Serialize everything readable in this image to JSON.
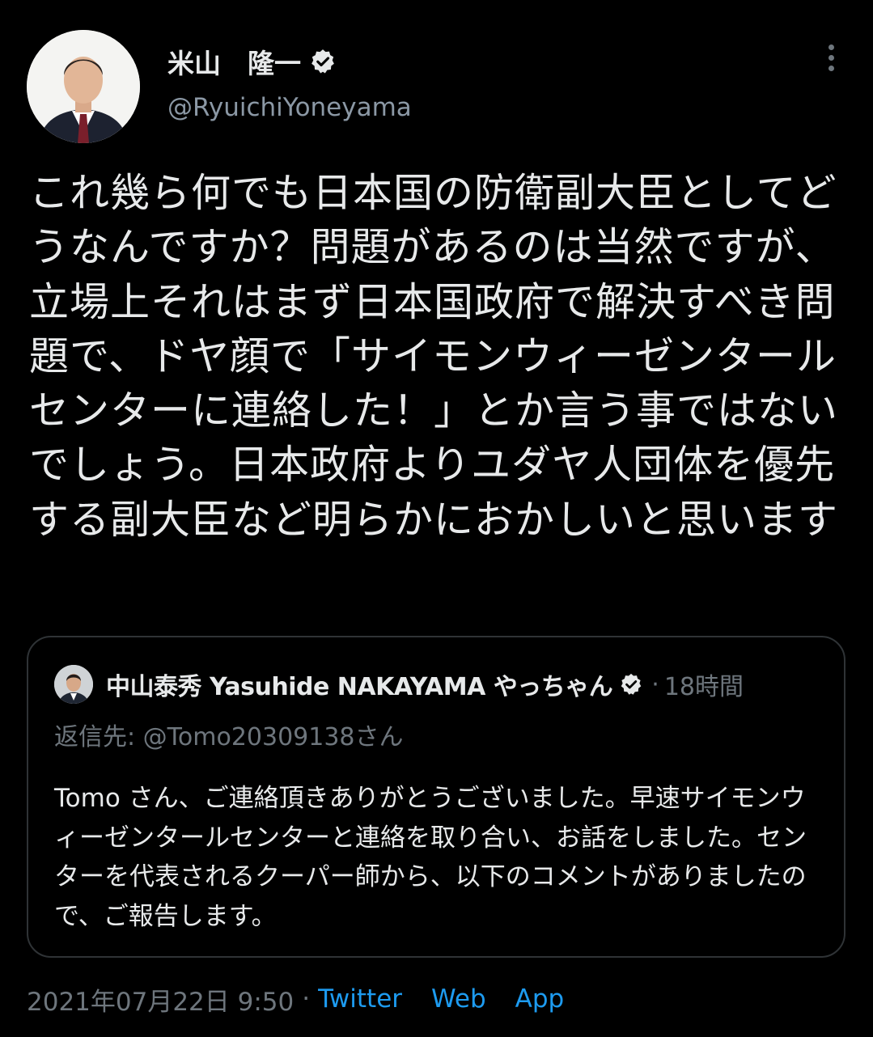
{
  "author": {
    "display_name": "米山　隆一",
    "handle": "@RyuichiYoneyama",
    "verified": true
  },
  "more_icon": "more-vertical-icon",
  "tweet_text": "これ幾ら何でも日本国の防衛副大臣としてどうなんですか？問題があるのは当然ですが、立場上それはまず日本国政府で解決すべき問題で、ドヤ顔で「サイモンウィーゼンタールセンターに連絡した！」とか言う事ではないでしょう。日本政府よりユダヤ人団体を優先する副大臣など明らかにおかしいと思います",
  "quoted_tweet": {
    "display_name": "中山泰秀 Yasuhide NAKAYAMA やっちゃん",
    "verified": true,
    "separator": "·",
    "time": "18時間",
    "reply_label": "返信先: ",
    "reply_handle": "@Tomo20309138さん",
    "text": "Tomo さん、ご連絡頂きありがとうございました。早速サイモンウィーゼンタールセンターと連絡を取り合い、お話をしました。センターを代表されるクーパー師から、以下のコメントがありましたので、ご報告します。"
  },
  "footer": {
    "timestamp": "2021年07月22日 9:50",
    "separator": "·",
    "source_words": [
      "Twitter",
      "Web",
      "App"
    ]
  },
  "colors": {
    "background": "#000000",
    "text": "#e7e9ea",
    "secondary": "#6e767d",
    "link": "#1d9bf0",
    "border": "#2f3336"
  }
}
